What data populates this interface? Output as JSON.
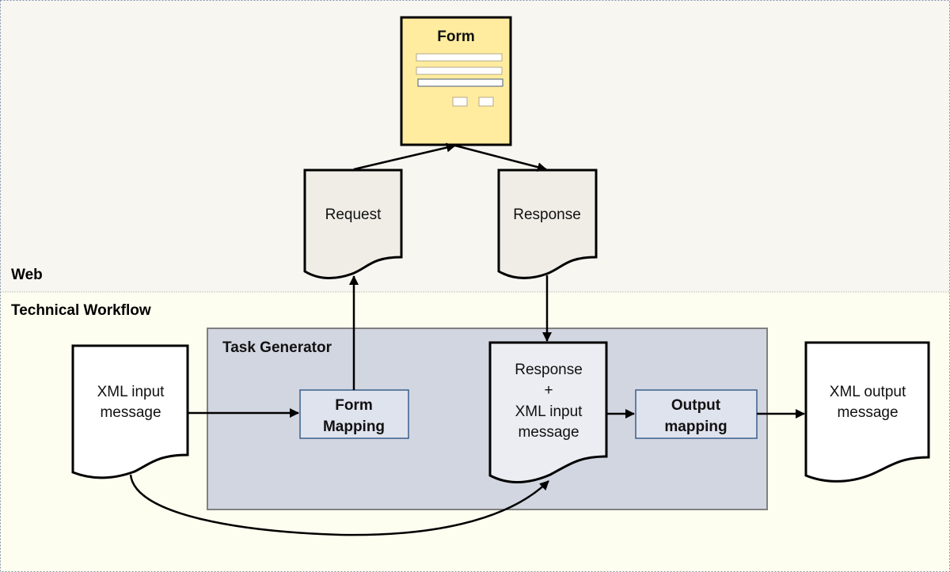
{
  "diagram": {
    "lanes": {
      "web": {
        "label": "Web",
        "color": "#f7f6f1"
      },
      "technical": {
        "label": "Technical Workflow",
        "color": "#fefef0"
      }
    },
    "form": {
      "title": "Form",
      "fill": "#ffec9e",
      "field_count": 3,
      "button_count": 2
    },
    "request_doc": {
      "label": "Request",
      "fill": "#efede6"
    },
    "response_doc": {
      "label": "Response",
      "fill": "#efede6"
    },
    "task_generator": {
      "label": "Task Generator",
      "fill": "#d2d6e1"
    },
    "form_mapping": {
      "line1": "Form",
      "line2": "Mapping",
      "fill": "#dfe3ee",
      "border": "#3a5f8a"
    },
    "combined_doc": {
      "line1": "Response",
      "line2": "+",
      "line3": "XML input",
      "line4": "message",
      "fill": "#ecedf3"
    },
    "output_mapping": {
      "line1": "Output",
      "line2": "mapping",
      "fill": "#dfe3ee",
      "border": "#3a5f8a"
    },
    "xml_input": {
      "line1": "XML input",
      "line2": "message",
      "fill": "#ffffff"
    },
    "xml_output": {
      "line1": "XML output",
      "line2": "message",
      "fill": "#ffffff"
    },
    "edges": [
      {
        "from": "xml_input",
        "to": "form_mapping"
      },
      {
        "from": "form_mapping",
        "to": "request_doc"
      },
      {
        "from": "request_doc",
        "to": "form"
      },
      {
        "from": "form",
        "to": "response_doc"
      },
      {
        "from": "response_doc",
        "to": "combined_doc"
      },
      {
        "from": "xml_input",
        "to": "combined_doc"
      },
      {
        "from": "combined_doc",
        "to": "output_mapping"
      },
      {
        "from": "output_mapping",
        "to": "xml_output"
      }
    ]
  }
}
